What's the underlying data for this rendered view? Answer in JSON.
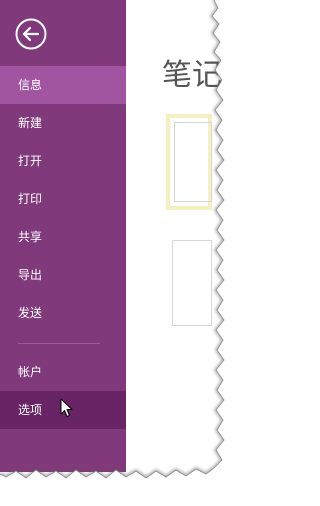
{
  "sidebar": {
    "back_icon": "back-arrow-circle-icon",
    "items": [
      {
        "label": "信息",
        "state": "selected"
      },
      {
        "label": "新建",
        "state": "normal"
      },
      {
        "label": "打开",
        "state": "normal"
      },
      {
        "label": "打印",
        "state": "normal"
      },
      {
        "label": "共享",
        "state": "normal"
      },
      {
        "label": "导出",
        "state": "normal"
      },
      {
        "label": "发送",
        "state": "normal"
      }
    ],
    "bottom_items": [
      {
        "label": "帐户",
        "state": "normal"
      },
      {
        "label": "选项",
        "state": "hover"
      }
    ]
  },
  "main": {
    "title": "笔记"
  },
  "colors": {
    "sidebar_bg": "#80397b",
    "selected_bg": "#a155a0",
    "hover_bg": "#692466",
    "thumb_highlight": "#f6efc2"
  }
}
